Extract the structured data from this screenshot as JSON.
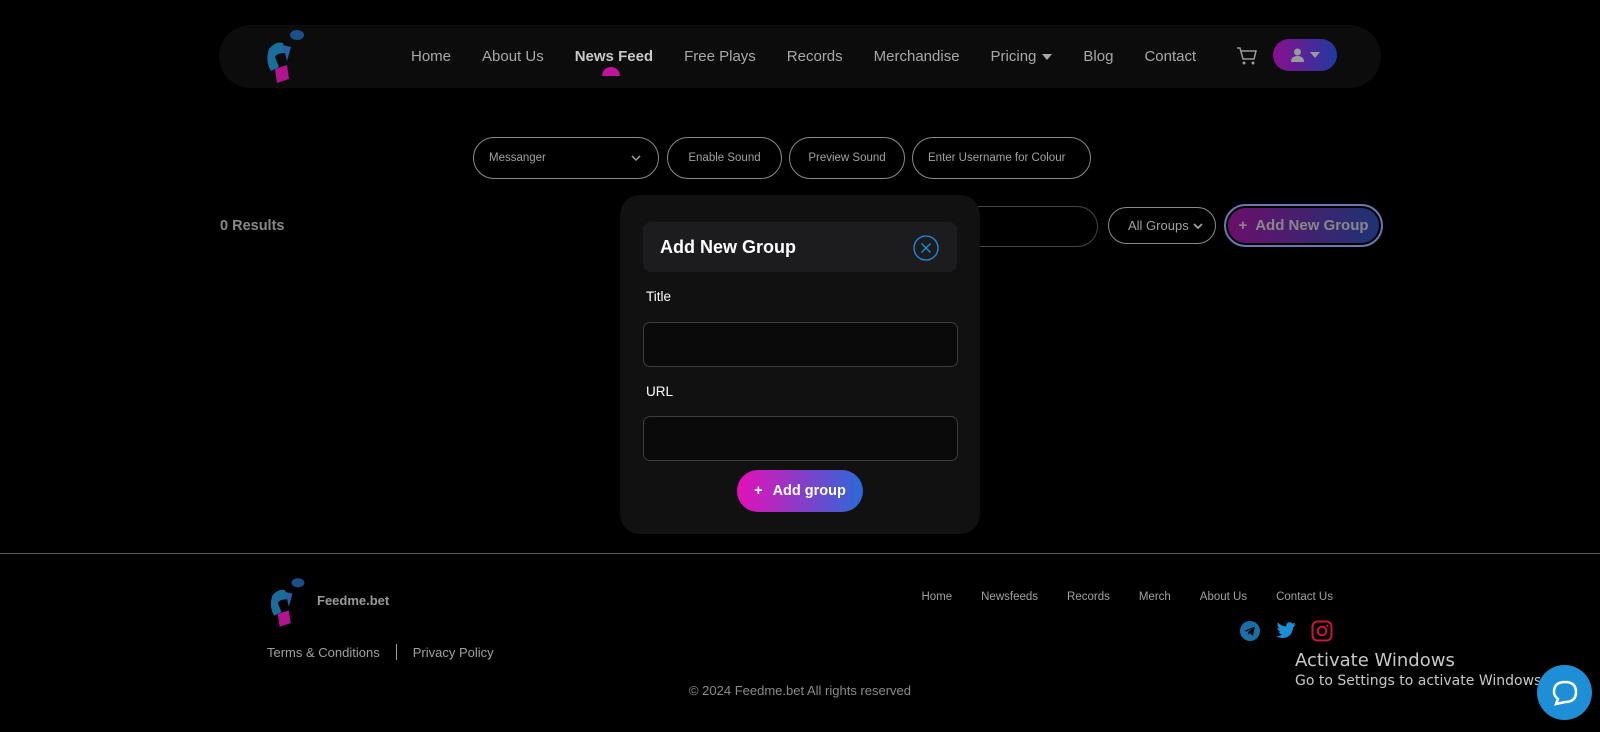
{
  "nav": {
    "items": [
      {
        "label": "Home"
      },
      {
        "label": "About Us"
      },
      {
        "label": "News Feed",
        "active": true
      },
      {
        "label": "Free Plays"
      },
      {
        "label": "Records"
      },
      {
        "label": "Merchandise"
      },
      {
        "label": "Pricing",
        "dropdown": true
      },
      {
        "label": "Blog"
      },
      {
        "label": "Contact"
      }
    ],
    "cart_icon": "cart-icon",
    "user_icon": "user-icon"
  },
  "toolbar": {
    "messenger_value": "Messanger",
    "enable_sound": "Enable Sound",
    "preview_sound": "Preview Sound",
    "username_placeholder": "Enter Username for Colour"
  },
  "results": {
    "count_label": "0 Results",
    "groups_filter": "All Groups",
    "add_new_group": "Add New Group",
    "add_icon": "+"
  },
  "modal": {
    "title": "Add New Group",
    "title_label": "Title",
    "title_value": "",
    "url_label": "URL",
    "url_value": "",
    "submit_label": "Add group",
    "submit_icon": "+"
  },
  "footer": {
    "brand": "Feedme.bet",
    "terms": "Terms & Conditions",
    "privacy": "Privacy Policy",
    "links": [
      "Home",
      "Newsfeeds",
      "Records",
      "Merch",
      "About Us",
      "Contact Us"
    ],
    "socials": [
      "telegram-icon",
      "twitter-icon",
      "instagram-icon"
    ],
    "copyright": "© 2024 Feedme.bet All rights reserved"
  },
  "windows": {
    "line1": "Activate Windows",
    "line2": "Go to Settings to activate Windows."
  },
  "colors": {
    "accent_pink": "#e60fb7",
    "accent_blue": "#2a6ad8",
    "background": "#000000"
  }
}
